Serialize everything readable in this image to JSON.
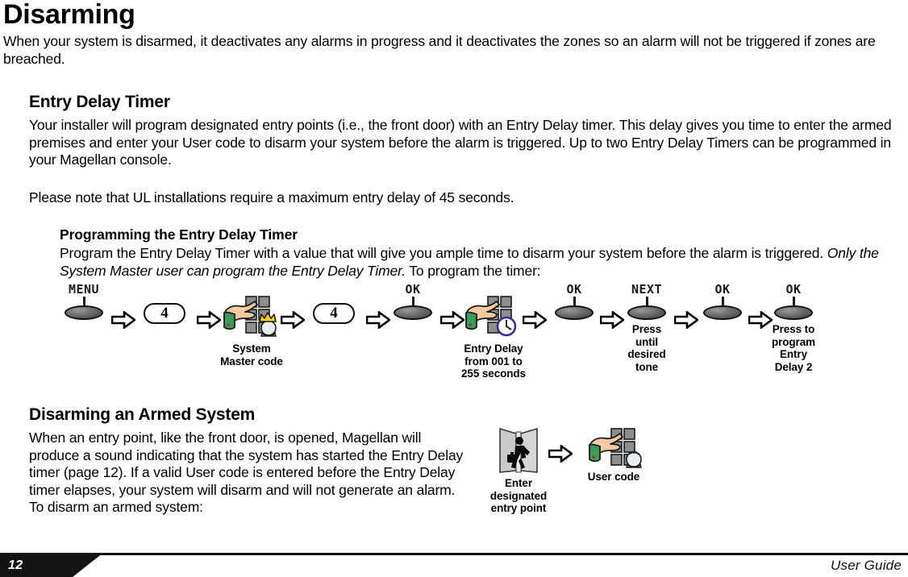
{
  "document": {
    "title": "Disarming",
    "intro": "When your system is disarmed, it deactivates any alarms in progress and it deactivates the zones so an alarm will not be triggered if zones are breached."
  },
  "entry_delay_section": {
    "heading": "Entry Delay Timer",
    "paragraph": "Your installer will program designated entry points (i.e., the front door) with an Entry Delay timer. This delay gives you time to enter the armed premises and enter your User code to disarm your system before the alarm is triggered. Up to two Entry Delay Timers can be programmed in your Magellan console.",
    "ul_note": "Please note that UL installations require a maximum entry delay of 45 seconds.",
    "sub_heading": "Programming the Entry Delay Timer",
    "sub_paragraph_1": "Program the Entry Delay Timer with a value that will give you ample time to disarm your system before the alarm is triggered.",
    "sub_paragraph_italic": "Only the System Master user can program the Entry Delay Timer.",
    "sub_paragraph_2": "To program the timer:"
  },
  "programming_diagram": {
    "steps": [
      {
        "type": "button",
        "cap": "MENU",
        "caption": ""
      },
      {
        "type": "arrow"
      },
      {
        "type": "key",
        "label": "4",
        "caption": ""
      },
      {
        "type": "arrow"
      },
      {
        "type": "keypad",
        "badge": "crown",
        "caption": "System\nMaster code"
      },
      {
        "type": "arrow"
      },
      {
        "type": "key",
        "label": "4",
        "caption": ""
      },
      {
        "type": "arrow"
      },
      {
        "type": "button",
        "cap": "OK",
        "caption": ""
      },
      {
        "type": "arrow"
      },
      {
        "type": "keypad",
        "badge": "clock",
        "caption": "Entry Delay\nfrom 001 to\n255 seconds"
      },
      {
        "type": "arrow"
      },
      {
        "type": "button",
        "cap": "OK",
        "caption": ""
      },
      {
        "type": "arrow"
      },
      {
        "type": "button",
        "cap": "NEXT",
        "caption": "Press\nuntil\ndesired\ntone"
      },
      {
        "type": "arrow"
      },
      {
        "type": "button",
        "cap": "OK",
        "caption": ""
      },
      {
        "type": "arrow"
      },
      {
        "type": "button",
        "cap": "OK",
        "caption": "Press to\nprogram\nEntry\nDelay 2"
      }
    ]
  },
  "disarming_section": {
    "heading": "Disarming an Armed System",
    "paragraph": "When an entry point, like the front door, is opened, Magellan will produce a sound indicating that the system has started the Entry Delay timer (page 12). If a valid User code is entered before the Entry Delay timer elapses, your system will disarm and will not generate an alarm. To disarm an armed system:",
    "diagram": {
      "door_caption": "Enter\ndesignated\nentry point",
      "keypad_caption": "User code"
    }
  },
  "footer": {
    "page_number": "12",
    "guide_label": "User Guide"
  },
  "colors": {
    "ink": "#000000",
    "footer_bar": "#131313",
    "button_body": "#6e6e6e",
    "skin": "#f3c9a0",
    "sleeve": "#2f8f4e",
    "key_gray": "#8a8a8a",
    "crown_gold": "#f5d400",
    "clock_navy": "#3a2f8f"
  }
}
